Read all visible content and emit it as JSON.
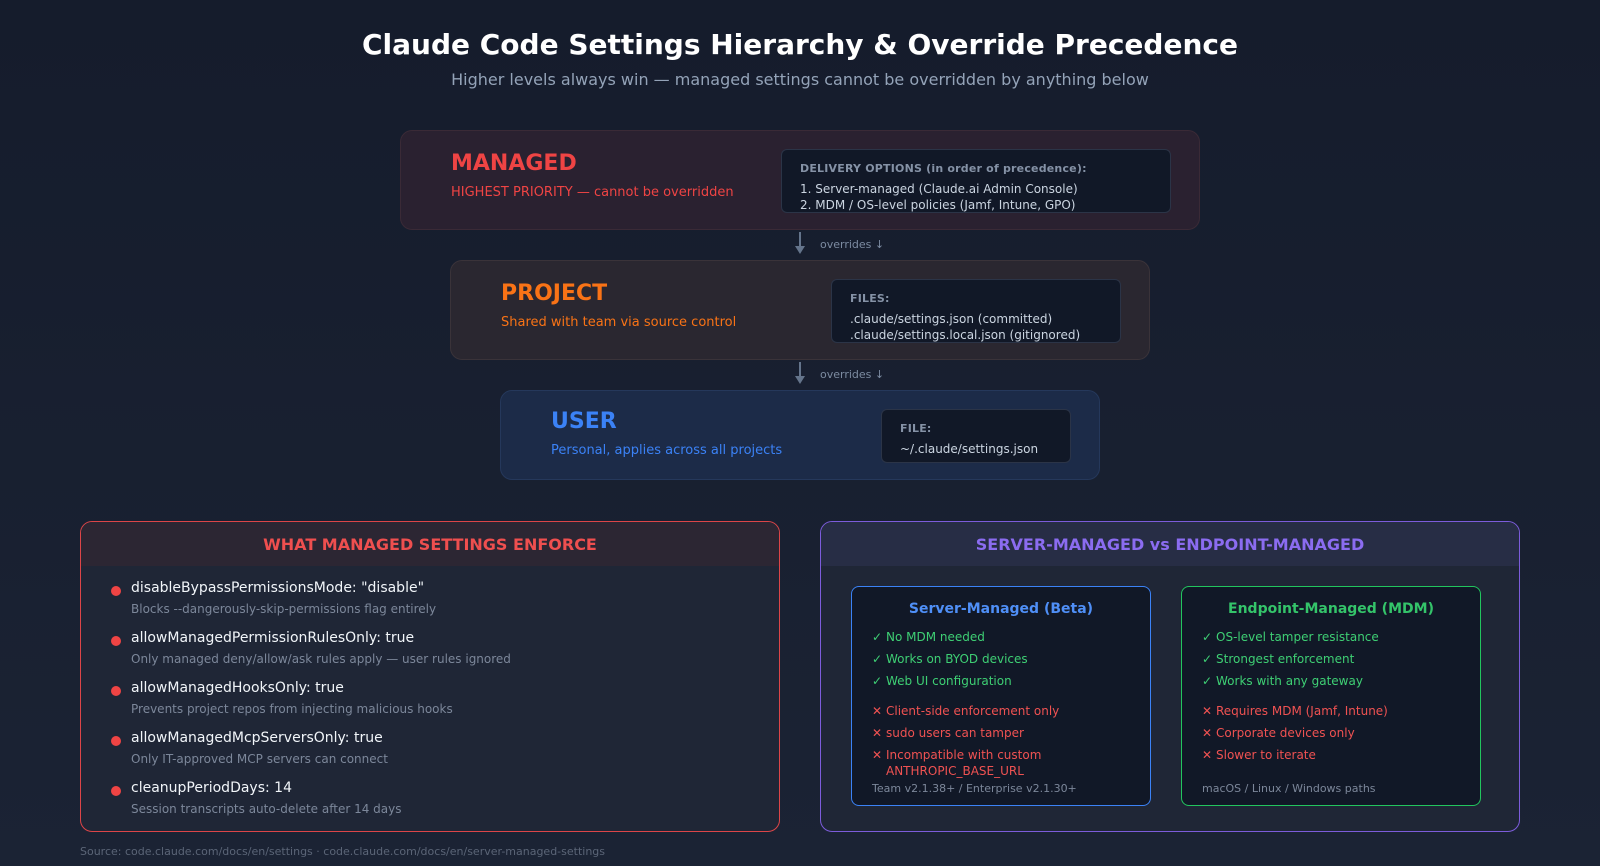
{
  "header": {
    "title": "Claude Code Settings Hierarchy & Override Precedence",
    "subtitle": "Higher levels always win — managed settings cannot be overridden by anything below"
  },
  "colors": {
    "managed": "#ef4444",
    "project": "#f97316",
    "user": "#3b82f6",
    "server_managed": "#3b82f6",
    "endpoint_managed": "#22c55e",
    "compare_accent": "#8b5cf6"
  },
  "tiers": {
    "managed": {
      "name": "MANAGED",
      "description": "HIGHEST PRIORITY — cannot be overridden",
      "info_heading": "DELIVERY OPTIONS (in order of precedence):",
      "info_lines": [
        "1. Server-managed (Claude.ai Admin Console)",
        "2. MDM / OS-level policies (Jamf, Intune, GPO)"
      ]
    },
    "project": {
      "name": "PROJECT",
      "description": "Shared with team via source control",
      "info_heading": "FILES:",
      "info_lines": [
        ".claude/settings.json (committed)",
        ".claude/settings.local.json (gitignored)"
      ]
    },
    "user": {
      "name": "USER",
      "description": "Personal, applies across all projects",
      "info_heading": "FILE:",
      "info_lines": [
        "~/.claude/settings.json"
      ]
    }
  },
  "connectors": [
    "overrides ↓",
    "overrides ↓"
  ],
  "enforce_panel": {
    "title": "WHAT MANAGED SETTINGS ENFORCE",
    "rules": [
      {
        "key": "disableBypassPermissionsMode: \"disable\"",
        "desc": "Blocks --dangerously-skip-permissions flag entirely"
      },
      {
        "key": "allowManagedPermissionRulesOnly: true",
        "desc": "Only managed deny/allow/ask rules apply — user rules ignored"
      },
      {
        "key": "allowManagedHooksOnly: true",
        "desc": "Prevents project repos from injecting malicious hooks"
      },
      {
        "key": "allowManagedMcpServersOnly: true",
        "desc": "Only IT-approved MCP servers can connect"
      },
      {
        "key": "cleanupPeriodDays: 14",
        "desc": "Session transcripts auto-delete after 14 days"
      }
    ]
  },
  "compare_panel": {
    "title": "SERVER-MANAGED vs ENDPOINT-MANAGED",
    "server": {
      "title": "Server-Managed (Beta)",
      "pros": [
        "No MDM needed",
        "Works on BYOD devices",
        "Web UI configuration"
      ],
      "cons": [
        "Client-side enforcement only",
        "sudo users can tamper",
        "Incompatible with custom ANTHROPIC_BASE_URL"
      ],
      "footer": "Team v2.1.38+ / Enterprise v2.1.30+"
    },
    "endpoint": {
      "title": "Endpoint-Managed (MDM)",
      "pros": [
        "OS-level tamper resistance",
        "Strongest enforcement",
        "Works with any gateway"
      ],
      "cons": [
        "Requires MDM (Jamf, Intune)",
        "Corporate devices only",
        "Slower to iterate"
      ],
      "footer": "macOS / Linux / Windows paths"
    },
    "pro_mark": "✓",
    "con_mark": "✕"
  },
  "source": "Source: code.claude.com/docs/en/settings · code.claude.com/docs/en/server-managed-settings"
}
